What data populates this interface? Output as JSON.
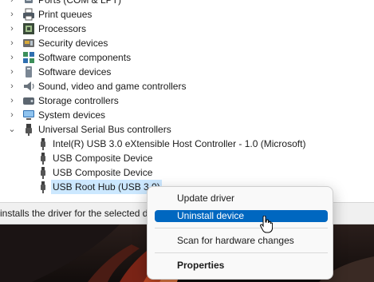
{
  "tree": {
    "items": [
      {
        "label": "Ports (COM & LPT)",
        "icon": "port-icon",
        "expand": "collapsed"
      },
      {
        "label": "Print queues",
        "icon": "printer-icon",
        "expand": "collapsed"
      },
      {
        "label": "Processors",
        "icon": "processor-icon",
        "expand": "collapsed"
      },
      {
        "label": "Security devices",
        "icon": "security-device-icon",
        "expand": "collapsed"
      },
      {
        "label": "Software components",
        "icon": "software-component-icon",
        "expand": "collapsed"
      },
      {
        "label": "Software devices",
        "icon": "software-device-icon",
        "expand": "collapsed"
      },
      {
        "label": "Sound, video and game controllers",
        "icon": "speaker-icon",
        "expand": "collapsed"
      },
      {
        "label": "Storage controllers",
        "icon": "storage-controller-icon",
        "expand": "collapsed"
      },
      {
        "label": "System devices",
        "icon": "system-device-icon",
        "expand": "collapsed"
      },
      {
        "label": "Universal Serial Bus controllers",
        "icon": "usb-icon",
        "expand": "expanded"
      },
      {
        "label": "Intel(R) USB 3.0 eXtensible Host Controller - 1.0 (Microsoft)",
        "icon": "usb-plug-icon",
        "child": true
      },
      {
        "label": "USB Composite Device",
        "icon": "usb-plug-icon",
        "child": true
      },
      {
        "label": "USB Composite Device",
        "icon": "usb-plug-icon",
        "child": true
      },
      {
        "label": "USB Root Hub (USB 3.0)",
        "icon": "usb-plug-icon",
        "child": true,
        "selected": true
      }
    ]
  },
  "status_bar": {
    "text": "installs the driver for the selected d"
  },
  "context_menu": {
    "items": [
      {
        "label": "Update driver",
        "highlighted": false,
        "bold": false
      },
      {
        "label": "Uninstall device",
        "highlighted": true,
        "bold": false
      },
      {
        "label": "Scan for hardware changes",
        "highlighted": false,
        "bold": false
      },
      {
        "label": "Properties",
        "highlighted": false,
        "bold": true
      }
    ]
  },
  "colors": {
    "selection": "#cce8ff",
    "menu_highlight": "#0067c0",
    "menu_background": "#f9f9f9",
    "status_background": "#f0f0f0"
  }
}
